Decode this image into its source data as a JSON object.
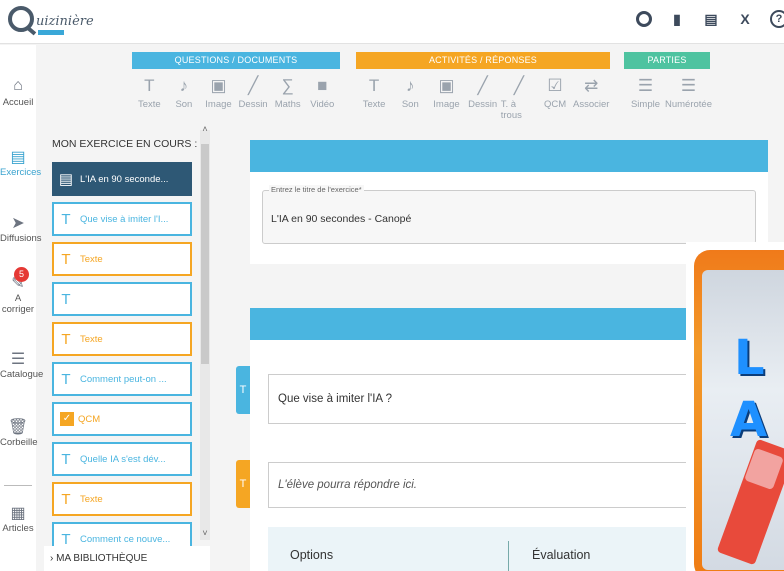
{
  "app": {
    "logo_text": "uizinière"
  },
  "topbar": {
    "icons": [
      "target-icon",
      "save-icon",
      "pdf-icon",
      "close-icon",
      "help-icon"
    ],
    "close": "X",
    "help": "?"
  },
  "toolbar": {
    "questions": {
      "title": "QUESTIONS / DOCUMENTS",
      "color": "#4ab5e0",
      "items": [
        {
          "label": "Texte",
          "icon": "T"
        },
        {
          "label": "Son",
          "icon": "♪"
        },
        {
          "label": "Image",
          "icon": "▣"
        },
        {
          "label": "Dessin",
          "icon": "╱"
        },
        {
          "label": "Maths",
          "icon": "∑"
        },
        {
          "label": "Vidéo",
          "icon": "■"
        }
      ]
    },
    "activites": {
      "title": "ACTIVITÉS / RÉPONSES",
      "color": "#f5a623",
      "items": [
        {
          "label": "Texte",
          "icon": "T"
        },
        {
          "label": "Son",
          "icon": "♪"
        },
        {
          "label": "Image",
          "icon": "▣"
        },
        {
          "label": "Dessin",
          "icon": "╱"
        },
        {
          "label": "T. à trous",
          "icon": "╱"
        },
        {
          "label": "QCM",
          "icon": "☑"
        },
        {
          "label": "Associer",
          "icon": "⇄"
        }
      ]
    },
    "parties": {
      "title": "PARTIES",
      "color": "#4ec3a0",
      "items": [
        {
          "label": "Simple",
          "icon": "☰"
        },
        {
          "label": "Numérotée",
          "icon": "☰"
        }
      ]
    }
  },
  "leftnav": {
    "items": [
      {
        "label": "Accueil",
        "icon": "⌂"
      },
      {
        "label": "Exercices",
        "icon": "▤"
      },
      {
        "label": "Diffusions",
        "icon": "➤"
      },
      {
        "label": "A corriger",
        "icon": "✎",
        "badge": "5"
      },
      {
        "label": "Catalogue",
        "icon": "☰"
      },
      {
        "label": "Corbeille",
        "icon": "🗑"
      },
      {
        "label": "Articles",
        "icon": "▦"
      }
    ]
  },
  "exercise_panel": {
    "title": "MON EXERCICE EN COURS :",
    "items": [
      {
        "label": "L'IA en 90 seconde...",
        "style": "selected",
        "icon": "▤"
      },
      {
        "label": "Que vise à imiter l'I...",
        "style": "blue",
        "icon": "T"
      },
      {
        "label": "Texte",
        "style": "orange",
        "icon": "T"
      },
      {
        "label": "",
        "style": "blue",
        "icon": "T"
      },
      {
        "label": "Texte",
        "style": "orange",
        "icon": "T"
      },
      {
        "label": "Comment peut-on ...",
        "style": "blue",
        "icon": "T"
      },
      {
        "label": "QCM",
        "style": "check",
        "icon": "✓"
      },
      {
        "label": "Quelle IA s'est dév...",
        "style": "blue",
        "icon": "T"
      },
      {
        "label": "Texte",
        "style": "orange",
        "icon": "T"
      },
      {
        "label": "Comment ce nouve...",
        "style": "blue",
        "icon": "T"
      }
    ],
    "library": "› MA BIBLIOTHÈQUE"
  },
  "editor": {
    "title_field_label": "Entrez le titre de l'exercice*",
    "title_value": "L'IA en 90 secondes - Canopé",
    "question_text": "Que vise à imiter l'IA ?",
    "answer_placeholder": "L'élève pourra répondre ici.",
    "options_label": "Options",
    "evaluation_label": "Évaluation"
  },
  "overlay": {
    "text_line1": "L",
    "text_line2": "A"
  }
}
